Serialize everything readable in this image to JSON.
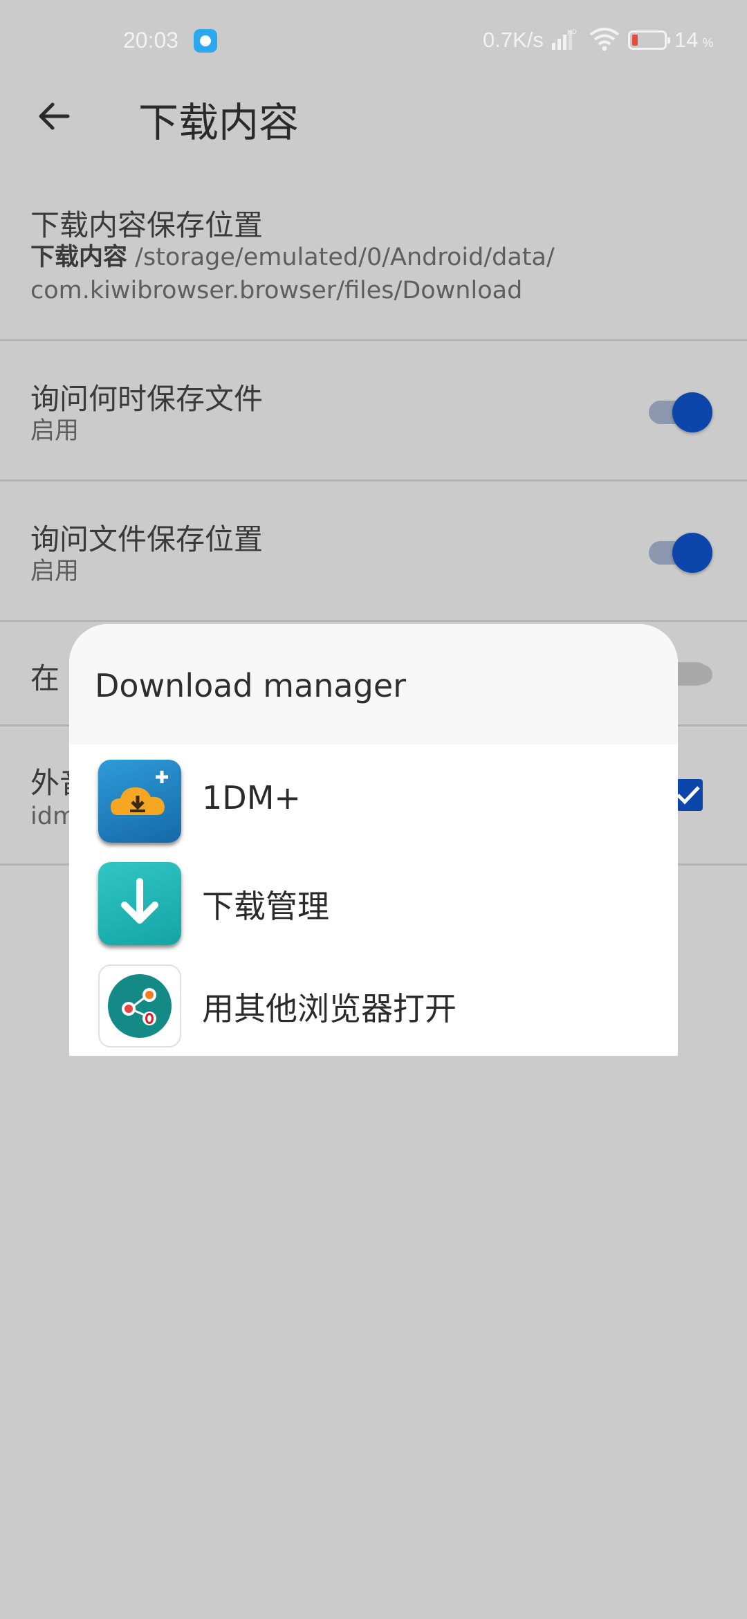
{
  "status_bar": {
    "time": "20:03",
    "speed": "0.7K/s",
    "battery_pct": "14",
    "battery_unit": "%",
    "icons": [
      "app-notification-icon",
      "signal-hd-icon",
      "wifi-icon",
      "battery-low-icon"
    ],
    "battery_level": 0.14
  },
  "toolbar": {
    "back_icon": "arrow-left-icon",
    "title": "下载内容"
  },
  "settings": {
    "save_location": {
      "title": "下载内容保存位置",
      "path_label": "下载内容",
      "path_line1": "/storage/emulated/0/Android/data/",
      "path_line2": "com.kiwibrowser.browser/files/Download"
    },
    "ask_when": {
      "title": "询问何时保存文件",
      "subtitle": "启用",
      "enabled": true
    },
    "ask_where": {
      "title": "询问文件保存位置",
      "subtitle": "启用",
      "enabled": true
    },
    "wifi_row": {
      "title_visible": "在"
    },
    "external_row": {
      "title_visible": "外音",
      "subtitle_visible": "idm",
      "checked": true
    }
  },
  "dialog": {
    "title": "Download manager",
    "items": [
      {
        "label": "1DM+",
        "icon": "1dm-plus-app-icon"
      },
      {
        "label": "下载管理",
        "icon": "download-manager-app-icon"
      },
      {
        "label": "用其他浏览器打开",
        "icon": "open-with-other-browser-icon"
      }
    ]
  },
  "colors": {
    "accent": "#0d46ab",
    "scrim_background": "#cbcbcb",
    "dialog_background": "#ffffff"
  }
}
